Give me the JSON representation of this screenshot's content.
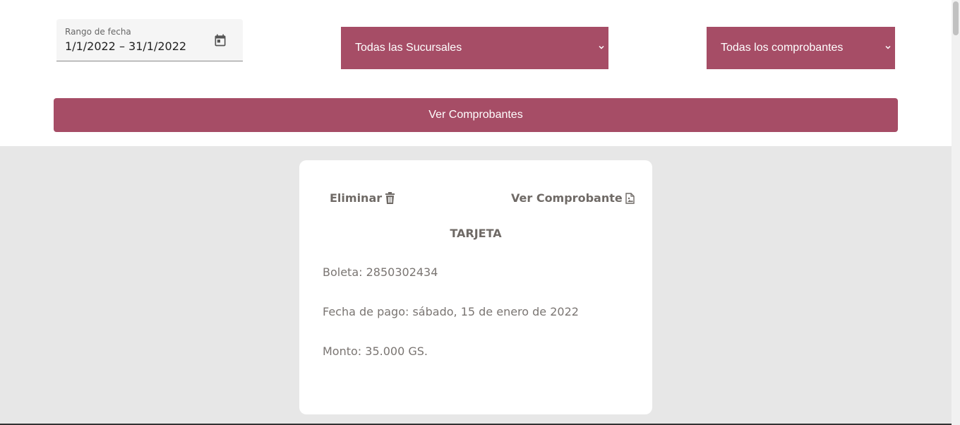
{
  "colors": {
    "accent": "#a64d66",
    "page_bg": "#e7e7e7",
    "card_bg": "#ffffff",
    "muted_text": "#6f6a66"
  },
  "filters": {
    "date": {
      "label": "Rango de fecha",
      "value": "1/1/2022 – 31/1/2022",
      "icon": "calendar-icon"
    },
    "branch_select": {
      "selected": "Todas las Sucursales",
      "icon": "chevron-down-icon"
    },
    "voucher_select": {
      "selected": "Todas los comprobantes",
      "icon": "chevron-down-icon"
    },
    "submit_label": "Ver Comprobantes"
  },
  "card": {
    "delete_label": "Eliminar",
    "delete_icon": "trash-icon",
    "view_label": "Ver Comprobante",
    "view_icon": "file-image-icon",
    "title": "TARJETA",
    "boleta": "Boleta: 2850302434",
    "fecha": "Fecha de pago: sábado, 15 de enero de 2022",
    "monto": "Monto: 35.000 GS."
  }
}
